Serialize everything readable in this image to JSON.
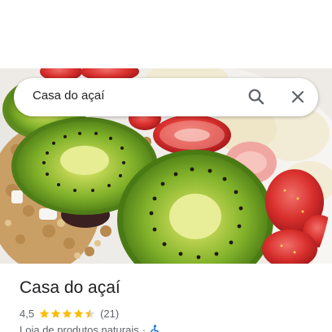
{
  "search": {
    "query": "Casa do açaí"
  },
  "place": {
    "name": "Casa do açaí",
    "rating": "4,5",
    "rating_value": 4.5,
    "max_stars": 5,
    "review_count": "(21)",
    "category": "Loja de produtos naturais",
    "separator": "·"
  },
  "icons": {
    "search": "search-icon",
    "clear": "close-icon",
    "star": "star-icon",
    "accessibility": "wheelchair-icon"
  },
  "colors": {
    "star": "#fbbc04",
    "star_empty": "#dadce0",
    "text_primary": "#202124",
    "text_secondary": "#5f6368",
    "accessibility": "#1a73e8"
  }
}
